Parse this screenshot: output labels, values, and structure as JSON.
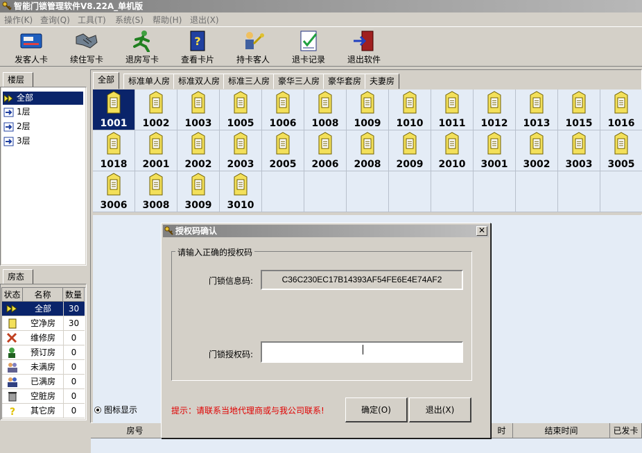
{
  "app": {
    "title": "智能门锁管理软件V8.22A_单机版"
  },
  "menu": [
    "操作(K)",
    "查询(Q)",
    "工具(T)",
    "系统(S)",
    "帮助(H)",
    "退出(X)"
  ],
  "toolbar": [
    "发客人卡",
    "续住写卡",
    "退房写卡",
    "查看卡片",
    "持卡客人",
    "退卡记录",
    "退出软件"
  ],
  "floor_panel": {
    "tab": "楼层",
    "items": [
      "全部",
      "1层",
      "2层",
      "3层"
    ]
  },
  "status_panel": {
    "tab": "房态",
    "headers": [
      "状态",
      "名称",
      "数量"
    ],
    "rows": [
      {
        "name": "全部",
        "count": "30"
      },
      {
        "name": "空净房",
        "count": "30"
      },
      {
        "name": "维修房",
        "count": "0"
      },
      {
        "name": "预订房",
        "count": "0"
      },
      {
        "name": "未满房",
        "count": "0"
      },
      {
        "name": "已满房",
        "count": "0"
      },
      {
        "name": "空脏房",
        "count": "0"
      },
      {
        "name": "其它房",
        "count": "0"
      }
    ]
  },
  "room_tabs": [
    "全部",
    "标准单人房",
    "标准双人房",
    "标准三人房",
    "豪华三人房",
    "豪华套房",
    "夫妻房"
  ],
  "rooms": [
    "1001",
    "1002",
    "1003",
    "1005",
    "1006",
    "1008",
    "1009",
    "1010",
    "1011",
    "1012",
    "1013",
    "1015",
    "1016",
    "1018",
    "2001",
    "2002",
    "2003",
    "2005",
    "2006",
    "2008",
    "2009",
    "2010",
    "3001",
    "3002",
    "3003",
    "3005",
    "3006",
    "3008",
    "3009",
    "3010"
  ],
  "view_option": "图标显示",
  "bottom_headers": [
    "房号",
    "时",
    "结束时间",
    "已发卡"
  ],
  "dialog": {
    "title": "授权码确认",
    "group": "请输入正确的授权码",
    "info_label": "门锁信息码:",
    "info_value": "C36C230EC17B14393AF54FE6E4E74AF2",
    "auth_label": "门锁授权码:",
    "auth_value": "",
    "hint": "提示：请联系当地代理商或与我公司联系!",
    "ok": "确定(O)",
    "cancel": "退出(X)"
  },
  "colors": {
    "selection": "#0a246a",
    "tag": "#f3e05a",
    "hint": "#e00000"
  }
}
